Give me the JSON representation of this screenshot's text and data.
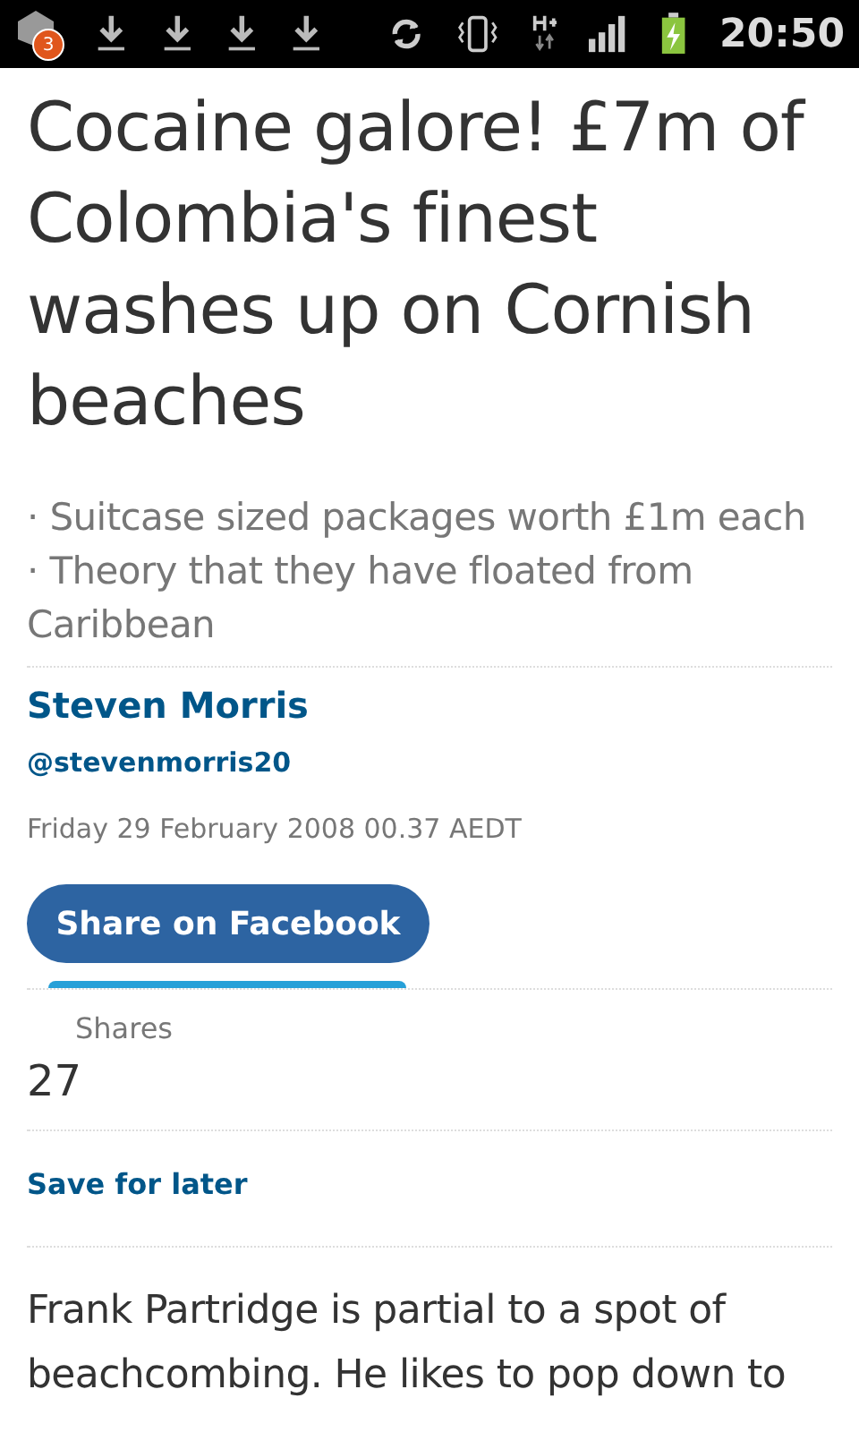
{
  "status_bar": {
    "notification_count": "3",
    "time": "20:50"
  },
  "article": {
    "headline": "Cocaine galore! £7m of Colombia's finest washes up on Cornish beaches",
    "standfirst": [
      "Suitcase sized packages worth £1m each",
      "Theory that they have floated from Caribbean"
    ],
    "bullet": "·",
    "author": "Steven Morris",
    "handle": "@stevenmorris20",
    "date": "Friday 29 February 2008 00.37 AEDT",
    "share_button": "Share on Facebook",
    "shares_label": "Shares",
    "shares_count": "27",
    "save": "Save for later",
    "body": "Frank Partridge is partial to a spot of beachcombing. He likes to pop down to"
  }
}
